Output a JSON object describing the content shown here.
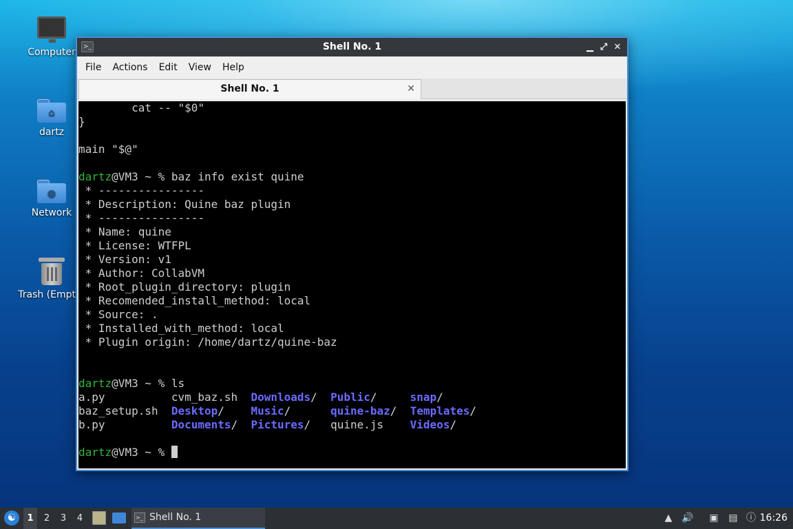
{
  "desktop": {
    "icons": [
      {
        "label": "Computer"
      },
      {
        "label": "dartz"
      },
      {
        "label": "Network"
      },
      {
        "label": "Trash (Empty)"
      }
    ]
  },
  "window": {
    "title": "Shell No. 1",
    "controls": {
      "minimize": "▁",
      "maximize": "⤢",
      "close": "✕"
    },
    "menu": [
      "File",
      "Actions",
      "Edit",
      "View",
      "Help"
    ],
    "tab": {
      "label": "Shell No. 1",
      "close": "✕"
    }
  },
  "terminal": {
    "lines": [
      {
        "text": "        cat -- \"$0\""
      },
      {
        "text": "}"
      },
      {
        "text": ""
      },
      {
        "text": "main \"$@\""
      },
      {
        "text": ""
      },
      {
        "prompt": "dartz",
        "host": "@VM3 ~ % ",
        "cmd": "baz info exist quine"
      },
      {
        "text": " * ----------------"
      },
      {
        "text": " * Description: Quine baz plugin"
      },
      {
        "text": " * ----------------"
      },
      {
        "text": " * Name: quine"
      },
      {
        "text": " * License: WTFPL"
      },
      {
        "text": " * Version: v1"
      },
      {
        "text": " * Author: CollabVM"
      },
      {
        "text": " * Root_plugin_directory: plugin"
      },
      {
        "text": " * Recomended_install_method: local"
      },
      {
        "text": " * Source: ."
      },
      {
        "text": " * Installed_with_method: local"
      },
      {
        "text": " * Plugin origin: /home/dartz/quine-baz"
      },
      {
        "text": ""
      },
      {
        "text": ""
      },
      {
        "prompt": "dartz",
        "host": "@VM3 ~ % ",
        "cmd": "ls"
      }
    ],
    "ls_rows": [
      [
        "a.py",
        "cvm_baz.sh",
        "Downloads/",
        "Public/",
        "snap/"
      ],
      [
        "baz_setup.sh",
        "Desktop/",
        "Music/",
        "quine-baz/",
        "Templates/"
      ],
      [
        "b.py",
        "Documents/",
        "Pictures/",
        "quine.js",
        "Videos/"
      ]
    ],
    "final_prompt": {
      "prompt": "dartz",
      "host": "@VM3 ~ % "
    }
  },
  "taskbar": {
    "start_glyph": "☯",
    "workspaces": [
      "1",
      "2",
      "3",
      "4"
    ],
    "task_label": "Shell No. 1",
    "clock": "16:26"
  }
}
